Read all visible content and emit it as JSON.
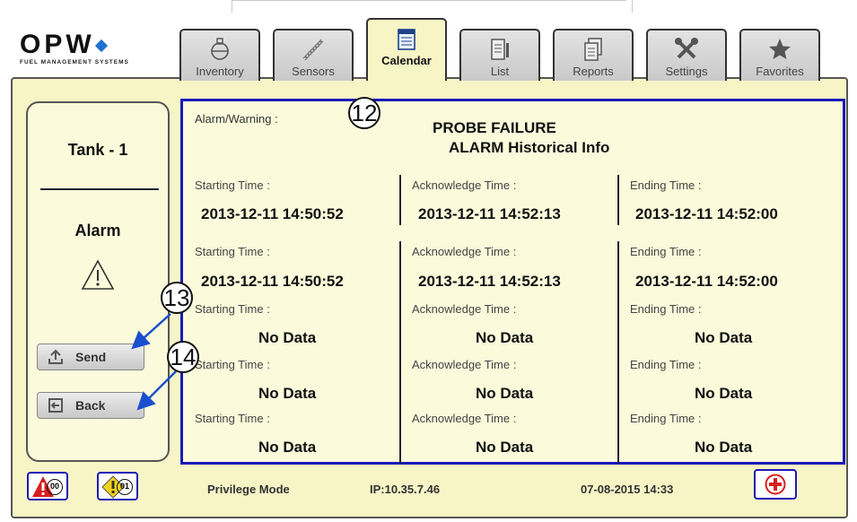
{
  "brand": {
    "name": "OPW",
    "tagline": "FUEL MANAGEMENT SYSTEMS"
  },
  "tabs": [
    {
      "label": "Inventory",
      "icon": "flask-icon"
    },
    {
      "label": "Sensors",
      "icon": "probe-icon"
    },
    {
      "label": "Calendar",
      "icon": "calendar-icon",
      "active": true
    },
    {
      "label": "List",
      "icon": "list-icon"
    },
    {
      "label": "Reports",
      "icon": "reports-icon"
    },
    {
      "label": "Settings",
      "icon": "tools-icon"
    },
    {
      "label": "Favorites",
      "icon": "star-icon"
    }
  ],
  "sidebar": {
    "tank": "Tank - 1",
    "state": "Alarm",
    "send_label": "Send",
    "back_label": "Back"
  },
  "panel": {
    "alarm_label": "Alarm/Warning :",
    "title_line1": "PROBE FAILURE",
    "title_line2": "ALARM Historical Info",
    "headers": {
      "start": "Starting Time :",
      "ack": "Acknowledge Time :",
      "end": "Ending Time :"
    },
    "rows": [
      {
        "start": "2013-12-11 14:50:52",
        "ack": "2013-12-11 14:52:13",
        "end": "2013-12-11 14:52:00"
      },
      {
        "start": "2013-12-11 14:50:52",
        "ack": "2013-12-11 14:52:13",
        "end": "2013-12-11 14:52:00"
      },
      {
        "start": "No Data",
        "ack": "No Data",
        "end": "No Data"
      },
      {
        "start": "No Data",
        "ack": "No Data",
        "end": "No Data"
      },
      {
        "start": "No Data",
        "ack": "No Data",
        "end": "No Data"
      }
    ]
  },
  "callouts": {
    "panel": "12",
    "send": "13",
    "back": "14"
  },
  "status": {
    "alarm_count": "00",
    "warning_count": "01",
    "mode": "Privilege Mode",
    "ip": "IP:10.35.7.46",
    "datetime": "07-08-2015 14:33"
  },
  "colors": {
    "panel_border": "#1a1ab8",
    "background": "#f7f4c6",
    "alarm": "#d81e1e",
    "warning": "#f2d21b"
  }
}
